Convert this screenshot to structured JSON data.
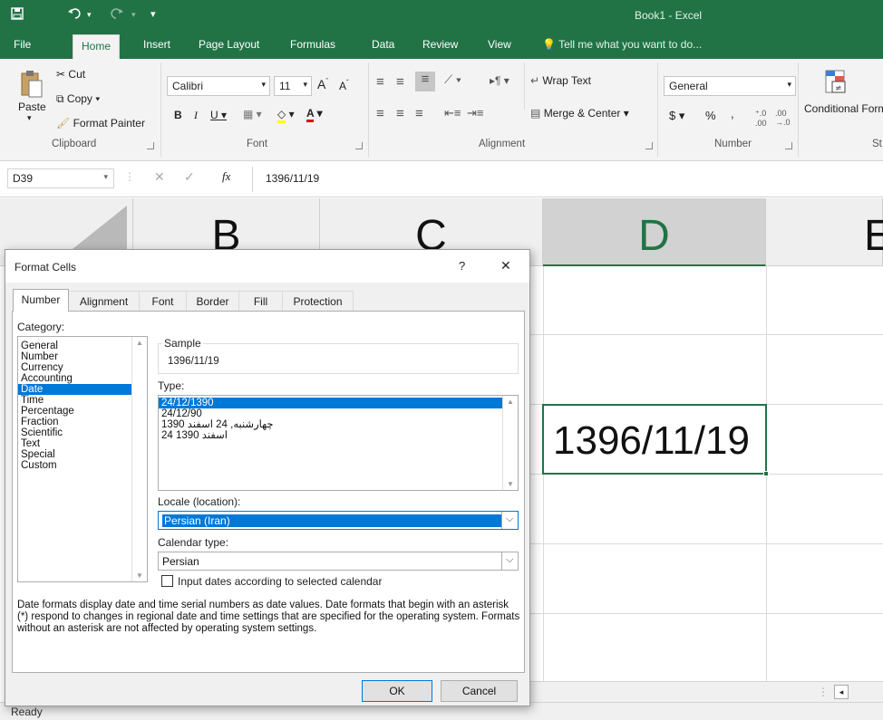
{
  "app": {
    "window_title": "Book1 - Excel"
  },
  "tabs": [
    "File",
    "Home",
    "Insert",
    "Page Layout",
    "Formulas",
    "Data",
    "Review",
    "View"
  ],
  "tell_me": "Tell me what you want to do...",
  "ribbon": {
    "clipboard": {
      "paste": "Paste",
      "cut": "Cut",
      "copy": "Copy",
      "format_painter": "Format Painter",
      "group": "Clipboard"
    },
    "font": {
      "name": "Calibri",
      "size": "11",
      "group": "Font"
    },
    "alignment": {
      "wrap_text": "Wrap Text",
      "merge_center": "Merge & Center",
      "group": "Alignment"
    },
    "number": {
      "format": "General",
      "group": "Number",
      "currency": "$",
      "percent": "%",
      "comma": ","
    },
    "styles": {
      "conditional_formatting": "Conditional Formatting",
      "group": "St"
    }
  },
  "formula_bar": {
    "name_box": "D39",
    "fx": "fx",
    "formula": "1396/11/19"
  },
  "grid": {
    "columns": [
      "B",
      "C",
      "D",
      "E"
    ],
    "selected_column": "D",
    "cell_value": "1396/11/19"
  },
  "status": {
    "text": "Ready"
  },
  "dialog": {
    "title": "Format Cells",
    "help": "?",
    "close": "✕",
    "tabs": [
      "Number",
      "Alignment",
      "Font",
      "Border",
      "Fill",
      "Protection"
    ],
    "category_label": "Category:",
    "categories": [
      "General",
      "Number",
      "Currency",
      "Accounting",
      "Date",
      "Time",
      "Percentage",
      "Fraction",
      "Scientific",
      "Text",
      "Special",
      "Custom"
    ],
    "selected_category": "Date",
    "sample_label": "Sample",
    "sample_value": "1396/11/19",
    "type_label": "Type:",
    "types": [
      "24/12/1390",
      "24/12/90",
      "چهارشنبه, 24 اسفند 1390",
      "24 اسفند 1390"
    ],
    "selected_type": "24/12/1390",
    "locale_label": "Locale (location):",
    "locale_value": "Persian (Iran)",
    "calendar_label": "Calendar type:",
    "calendar_value": "Persian",
    "input_dates_label": "Input dates according to selected calendar",
    "description": "Date formats display date and time serial numbers as date values.  Date formats that begin with an asterisk (*) respond to changes in regional date and time settings that are specified for the operating system. Formats without an asterisk are not affected by operating system settings.",
    "ok": "OK",
    "cancel": "Cancel"
  }
}
